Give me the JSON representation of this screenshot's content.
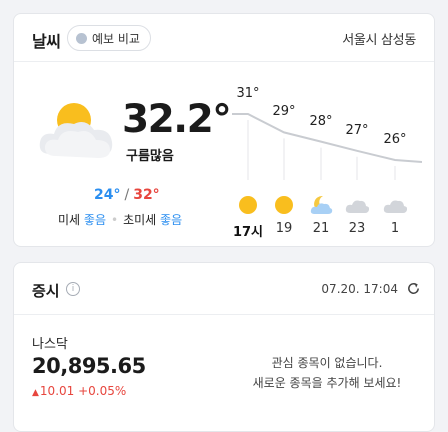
{
  "weather": {
    "title": "날씨",
    "compare_label": "예보 비교",
    "location": "서울시 삼성동",
    "current_icon": "partly-cloudy-icon",
    "current_temp": "32.2°",
    "condition": "구름많음",
    "min_temp": "24°",
    "separator": "/",
    "max_temp": "32°",
    "fine_dust_label": "미세",
    "fine_dust_value": "좋음",
    "ultrafine_dust_label": "초미세",
    "ultrafine_dust_value": "좋음",
    "hourly": [
      {
        "temp": "31°",
        "value": 31,
        "time": "17시",
        "icon": "sun-icon",
        "now": true
      },
      {
        "temp": "29°",
        "value": 29,
        "time": "19",
        "icon": "sun-icon",
        "now": false
      },
      {
        "temp": "28°",
        "value": 28,
        "time": "21",
        "icon": "moon-cloud-icon",
        "now": false
      },
      {
        "temp": "27°",
        "value": 27,
        "time": "23",
        "icon": "cloud-icon",
        "now": false
      },
      {
        "temp": "26°",
        "value": 26,
        "time": "1",
        "icon": "cloud-icon",
        "now": false
      }
    ]
  },
  "stocks": {
    "title": "증시",
    "info_icon": "info-icon",
    "timestamp": "07.20. 17:04",
    "refresh_icon": "refresh-icon",
    "index_name": "나스닥",
    "index_value": "20,895.65",
    "change_arrow": "▲",
    "change_points": "10.01",
    "change_percent": "+0.05%",
    "empty_line1": "관심 종목이 없습니다.",
    "empty_line2": "새로운 종목을 추가해 보세요!"
  },
  "colors": {
    "accent_blue": "#2a8ef0",
    "accent_red": "#e7463e",
    "sun": "#f9be1e"
  }
}
